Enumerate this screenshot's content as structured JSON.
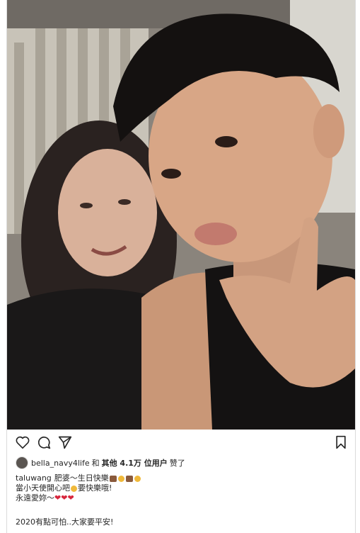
{
  "post": {
    "likes": {
      "username": "bella_navy4life",
      "and": "和",
      "others": "其他 4.1万 位用户",
      "suffix": "赞了"
    },
    "caption": {
      "username": "taluwang",
      "line1_text": "肥婆～生日快樂",
      "line2_a": "當小天使開心吧",
      "line2_b": "要快樂哦!",
      "line3": "永遠愛妳～"
    },
    "extra_text": "2020有點可怕..大家要平安!"
  },
  "icons": [
    "heart-icon",
    "comment-icon",
    "share-icon",
    "bookmark-icon"
  ],
  "colors": {
    "heart": "#d7263d",
    "text": "#262626",
    "border": "#dbdbdb"
  }
}
